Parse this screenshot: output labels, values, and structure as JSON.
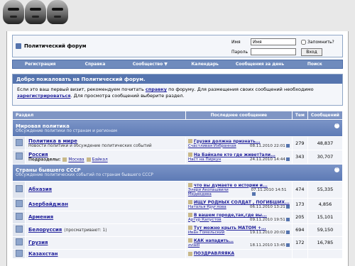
{
  "site": {
    "title": "Политический форум"
  },
  "login": {
    "user_label": "Имя",
    "user_value": "Имя",
    "pass_label": "Пароль",
    "remember_label": "Запомнить?",
    "submit_label": "Вход"
  },
  "navbar": [
    "Регистрация",
    "Справка",
    "Сообщество ▼",
    "Календарь",
    "Сообщения за день",
    "Поиск"
  ],
  "welcome": {
    "title": "Добро пожаловать на Политический форум.",
    "text1": "Если это ваш первый визит, рекомендуем почитать ",
    "link_help": "справку",
    "text2": " по форуму. Для размещения своих сообщений необходимо ",
    "link_register": "зарегистрироваться",
    "text3": ". Для просмотра сообщений выберите раздел."
  },
  "table": {
    "headers": {
      "section": "Раздел",
      "last": "Последнее сообщение",
      "threads": "Тем",
      "posts": "Сообщений"
    }
  },
  "categories": [
    {
      "title": "Мировая политика",
      "desc": "Обсуждение политики по странам и регионам",
      "forums": [
        {
          "name": "Политика в мире",
          "desc": "Новости политики и обсуждение политических событий",
          "last_title": "Грузия должна признать...",
          "last_user": "Счастливая Избранная",
          "last_date": "08.11.2010",
          "last_time": "22:01",
          "threads": "279",
          "posts": "48,837"
        },
        {
          "name": "Россия",
          "sub_label": "Подразделы:",
          "subs": [
            "Москва",
            "Байкал"
          ],
          "last_title": "На Байкале кто где живет?али...",
          "last_user": "Наст на Пиркун",
          "last_date": "24.11.2010",
          "last_time": "14:44",
          "threads": "343",
          "posts": "30,707"
        }
      ]
    },
    {
      "title": "Страны бывшего СССР",
      "desc": "Обсуждение политических событий по странам бывшего СССР",
      "forums": [
        {
          "name": "Абхазия",
          "last_title": "что вы думаете о истории и...",
          "last_user": "Элери Акопашвили Медведева",
          "last_date": "07.11.2010",
          "last_time": "14:51",
          "threads": "474",
          "posts": "55,335"
        },
        {
          "name": "Азербайджан",
          "last_title": "ИЩУ РОДНЫХ СОЛДАТ , ПОГИБШИХ...",
          "last_user": "Наталья Круглова",
          "last_date": "06.11.2010",
          "last_time": "13:21",
          "threads": "173",
          "posts": "4,856"
        },
        {
          "name": "Армения",
          "last_title": "В вашем городе,так,где вы...",
          "last_user": "Артур Капустов",
          "last_date": "09.11.2010",
          "last_time": "19:51",
          "threads": "205",
          "posts": "15,101"
        },
        {
          "name": "Белоруссия",
          "viewing": "(просматривают: 1)",
          "last_title": "Тут можно крыть МАТОМ +...",
          "last_user": "Иван Гомельский",
          "last_date": "19.11.2010",
          "last_time": "20:02",
          "threads": "694",
          "posts": "59,150"
        },
        {
          "name": "Грузия",
          "last_title": "КАК нападить...",
          "last_user": "zviadi",
          "last_date": "18.11.2010",
          "last_time": "13:45",
          "threads": "172",
          "posts": "16,785"
        },
        {
          "name": "Казахстан",
          "last_title": "ПОЗДРАВЛЯЯКА",
          "last_user": "",
          "last_date": "",
          "last_time": "",
          "threads": "",
          "posts": ""
        }
      ]
    }
  ]
}
